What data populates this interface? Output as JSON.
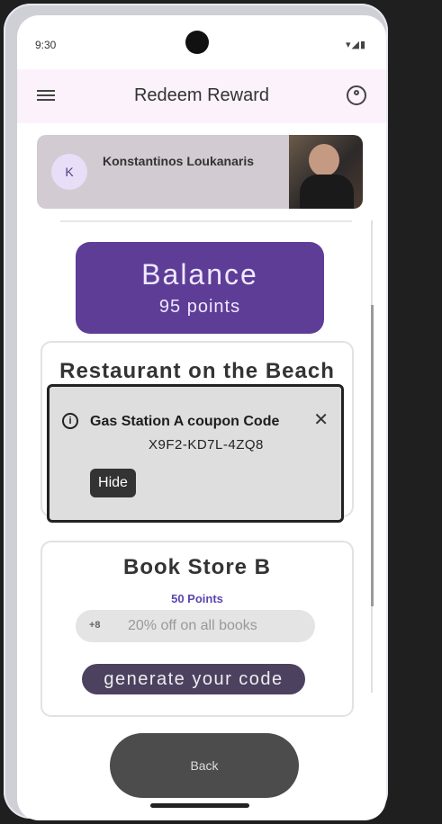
{
  "status_bar": {
    "time": "9:30",
    "icons": [
      "wifi-icon",
      "signal-icon",
      "battery-icon"
    ]
  },
  "app_bar": {
    "title": "Redeem Reward",
    "menu_icon": "menu-icon",
    "account_icon": "account-circle-icon"
  },
  "profile": {
    "initial": "K",
    "name": "Konstantinos Loukanaris"
  },
  "balance": {
    "title": "Balance",
    "points": "95 points"
  },
  "reward_card_1": {
    "title": "Restaurant on the Beach"
  },
  "coupon_dialog": {
    "title": "Gas Station A coupon Code",
    "code": "X9F2-KD7L-4ZQ8",
    "hide_label": "Hide",
    "info_icon": "info-icon",
    "close_icon": "close-icon"
  },
  "reward_card_2": {
    "title": "Book Store B",
    "points": "50 Points",
    "offer_count": "+8",
    "offer_text": "20% off on all books",
    "generate_label": "generate your code"
  },
  "back_label": "Back",
  "colors": {
    "primary": "#5e3d97",
    "app_bar_bg": "#fbf2fb",
    "button_dark": "#4d4160",
    "dialog_bg": "#dedede"
  }
}
